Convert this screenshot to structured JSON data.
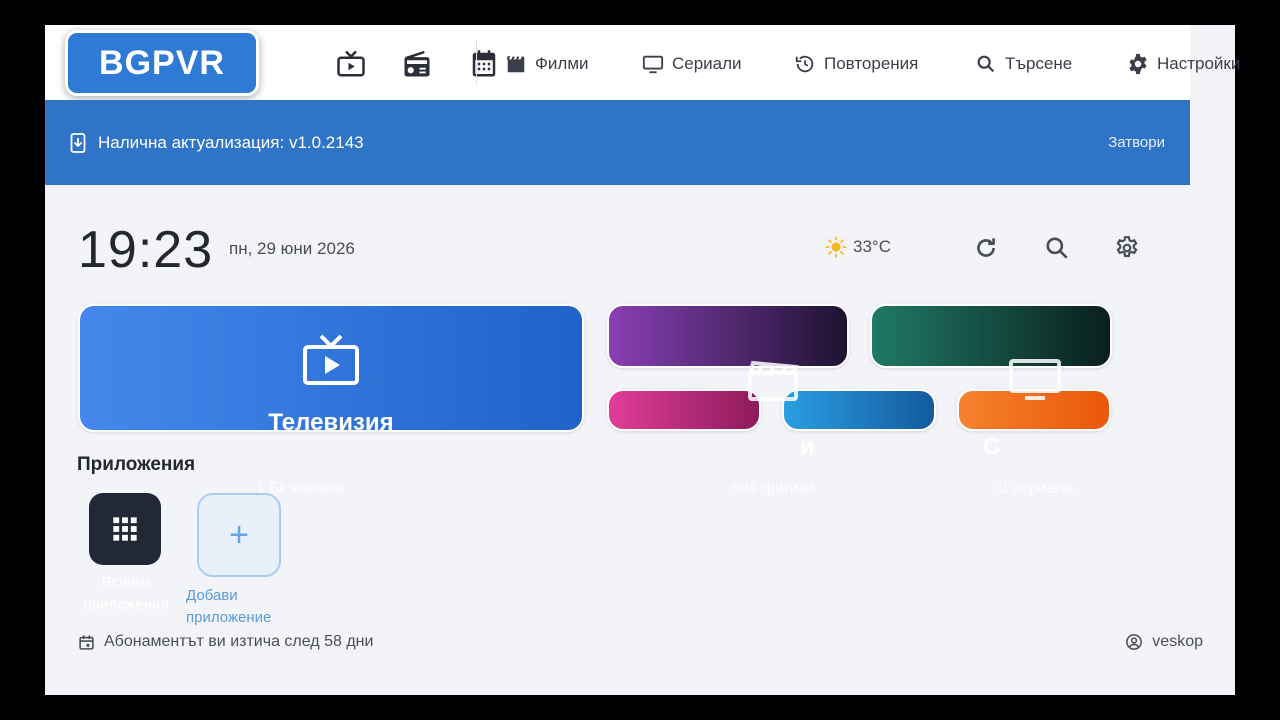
{
  "logo": {
    "text": "BGPVR"
  },
  "nav": {
    "icons": [
      "live-tv-icon",
      "radio-icon",
      "calendar-icon"
    ],
    "items": [
      {
        "label": "Филми",
        "icon": "clapperboard-icon"
      },
      {
        "label": "Сериали",
        "icon": "monitor-icon"
      },
      {
        "label": "Повторения",
        "icon": "history-icon"
      },
      {
        "label": "Търсене",
        "icon": "search-icon"
      },
      {
        "label": "Настройки",
        "icon": "gear-icon"
      }
    ]
  },
  "banner": {
    "text": "Налична актуализация: v1.0.2143",
    "close_label": "Затвори",
    "color": "#2f74c6"
  },
  "status": {
    "time": "19:23",
    "date": "пн, 29 юни 2026",
    "temperature": "33°C"
  },
  "tiles": {
    "tv": {
      "title": "Телевизия",
      "subtitle": "1.6k канала"
    },
    "movies": {
      "subtitle": "694 филми",
      "letter": "и"
    },
    "series": {
      "subtitle": "0 сериала",
      "letter": "С"
    }
  },
  "apps": {
    "title": "Приложения",
    "items": [
      {
        "label": "Всички приложения"
      }
    ],
    "add_label": "Добави приложение"
  },
  "footer": {
    "subscription": "Абонаментът ви изтича след 58 дни",
    "username": "veskop"
  }
}
